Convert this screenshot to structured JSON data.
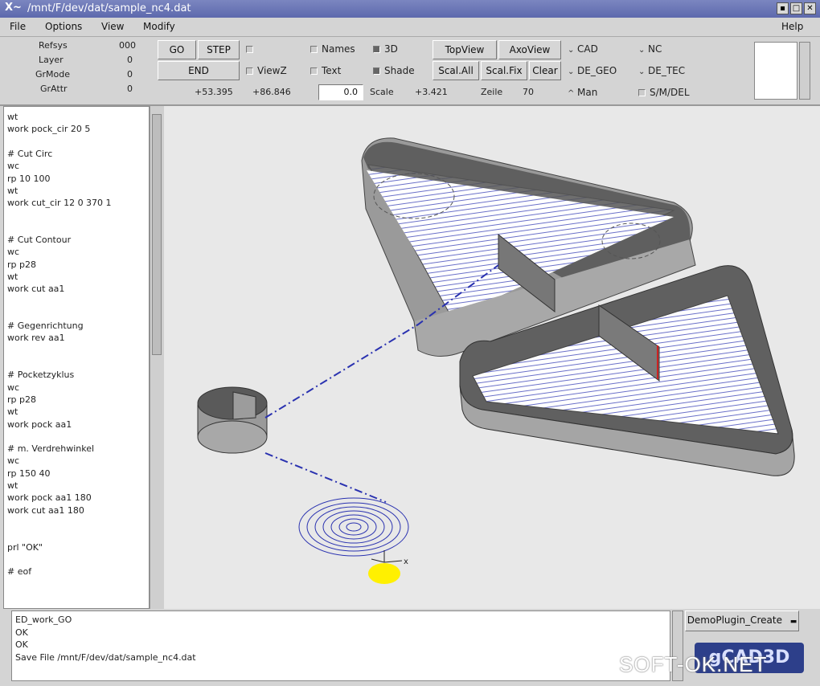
{
  "window": {
    "title": "/mnt/F/dev/dat/sample_nc4.dat"
  },
  "menubar": {
    "file": "File",
    "options": "Options",
    "view": "View",
    "modify": "Modify",
    "help": "Help"
  },
  "toolbar": {
    "status_labels": [
      "Refsys",
      "Layer",
      "GrMode",
      "GrAttr"
    ],
    "status_values": [
      "000",
      "0",
      "0",
      "0"
    ],
    "go": "GO",
    "step": "STEP",
    "end": "END",
    "viewz": "ViewZ",
    "names": "Names",
    "text": "Text",
    "three_d": "3D",
    "shade": "Shade",
    "topview": "TopView",
    "axoview": "AxoView",
    "scal_all": "Scal.All",
    "scal_fix": "Scal.Fix",
    "clear": "Clear",
    "cad": "CAD",
    "nc": "NC",
    "de_geo": "DE_GEO",
    "de_tec": "DE_TEC",
    "man": "Man",
    "sm_del": "S/M/DEL",
    "coord_x": "+53.395",
    "coord_y": "+86.846",
    "z_input": "0.0",
    "scale_label": "Scale",
    "scale_value": "+3.421",
    "zeile_label": "Zeile",
    "zeile_value": "70"
  },
  "editor": {
    "lines": [
      "wt",
      "work pock_cir 20 5",
      "",
      "# Cut Circ",
      "wc",
      "rp 10 100",
      "wt",
      "work cut_cir 12 0 370 1",
      "",
      "",
      "# Cut Contour",
      "wc",
      "rp p28",
      "wt",
      "work cut aa1",
      "",
      "",
      "# Gegenrichtung",
      "work rev aa1",
      "",
      "",
      "# Pocketzyklus",
      "wc",
      "rp p28",
      "wt",
      "work pock aa1",
      "",
      "# m. Verdrehwinkel",
      "wc",
      "rp 150 40",
      "wt",
      "work pock aa1 180",
      "work cut aa1 180",
      "",
      "",
      "prl \"OK\"",
      "",
      "# eof"
    ]
  },
  "console": {
    "lines": [
      "ED_work_GO",
      "OK",
      "OK",
      "Save File  /mnt/F/dev/dat/sample_nc4.dat"
    ]
  },
  "plugin": {
    "label": "DemoPlugin_Create"
  },
  "logo": {
    "text": "gCAD3D"
  },
  "watermark": {
    "text": "SOFT-OK.NET"
  }
}
